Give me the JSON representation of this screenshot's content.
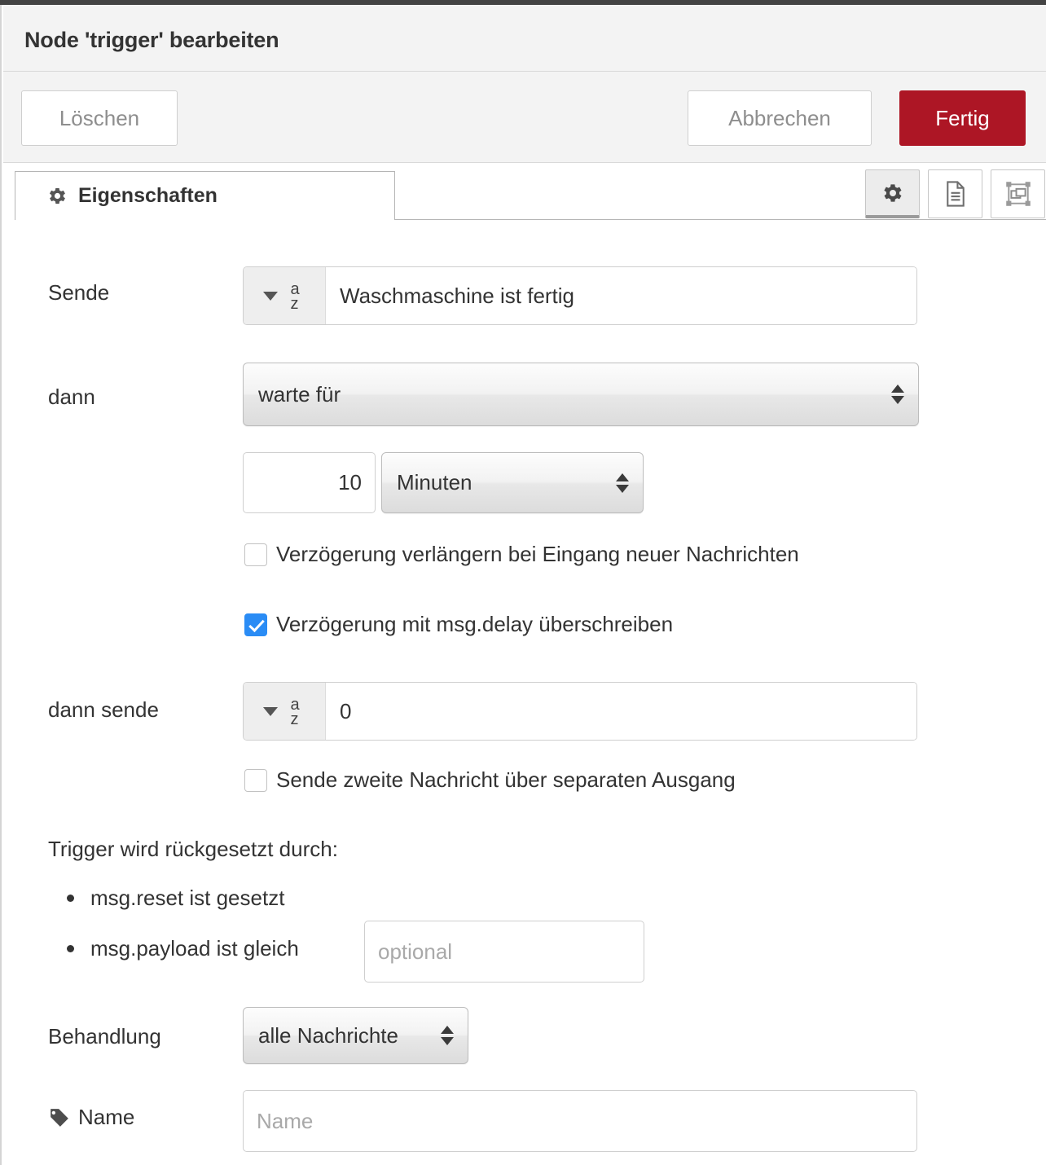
{
  "dialog": {
    "title": "Node 'trigger' bearbeiten",
    "buttons": {
      "delete": "Löschen",
      "cancel": "Abbrechen",
      "done": "Fertig"
    },
    "accent_red": "#ad1625",
    "accent_blue": "#2a8cf5"
  },
  "tabs": {
    "properties": {
      "label": "Eigenschaften",
      "icon": "gear-icon"
    },
    "icon_buttons": [
      {
        "name": "properties-icon-button",
        "icon": "gear-icon",
        "active": true
      },
      {
        "name": "description-icon-button",
        "icon": "document-icon",
        "active": false
      },
      {
        "name": "appearance-icon-button",
        "icon": "node-appearance-icon",
        "active": false
      }
    ]
  },
  "form": {
    "send": {
      "label": "Sende",
      "type_icon": "string-type-az-icon",
      "value": "Waschmaschine ist fertig"
    },
    "then": {
      "label": "dann",
      "action": "warte für",
      "duration_value": "10",
      "duration_unit": "Minuten"
    },
    "checkboxes": {
      "extend": {
        "label": "Verzögerung verlängern bei Eingang neuer Nachrichten",
        "checked": false
      },
      "override": {
        "label": "Verzögerung mit msg.delay überschreiben",
        "checked": true
      },
      "second_output": {
        "label": "Sende zweite Nachricht über separaten Ausgang",
        "checked": false
      }
    },
    "then_send": {
      "label": "dann sende",
      "type_icon": "string-type-az-icon",
      "value": "0"
    },
    "reset": {
      "title": "Trigger wird rückgesetzt durch:",
      "items": [
        {
          "text": "msg.reset ist gesetzt"
        },
        {
          "text": "msg.payload ist gleich"
        }
      ],
      "payload_placeholder": "optional",
      "payload_value": ""
    },
    "handling": {
      "label": "Behandlung",
      "value": "alle Nachrichte"
    },
    "name": {
      "label": "Name",
      "icon": "tag-icon",
      "placeholder": "Name",
      "value": ""
    }
  }
}
